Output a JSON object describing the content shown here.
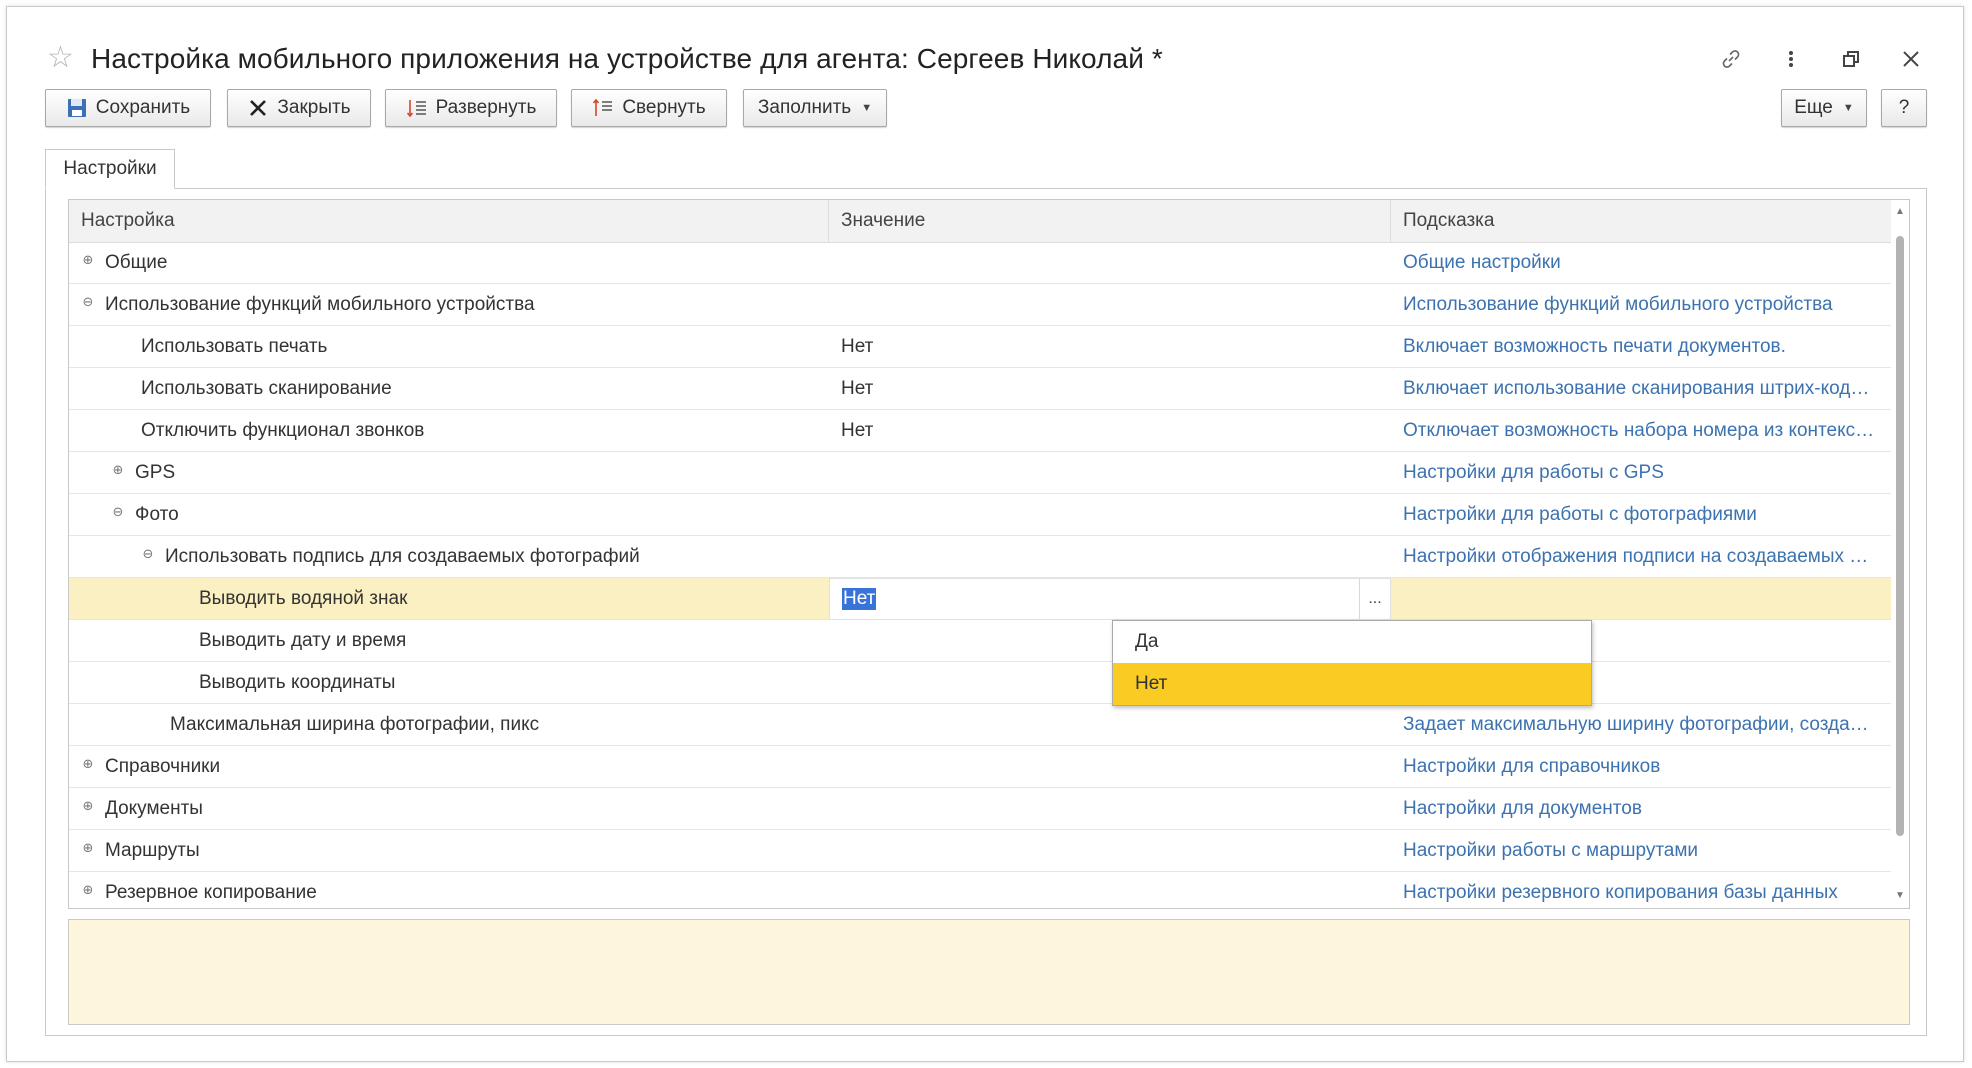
{
  "window": {
    "title": "Настройка мобильного приложения на устройстве для агента: Сергеев Николай *",
    "icons": [
      "star-icon",
      "link-icon",
      "more-icon",
      "restore-icon",
      "close-icon"
    ]
  },
  "toolbar": {
    "save_label": "Сохранить",
    "close_label": "Закрыть",
    "expand_label": "Развернуть",
    "collapse_label": "Свернуть",
    "fill_label": "Заполнить",
    "more_label": "Еще",
    "help_label": "?"
  },
  "tabs": [
    {
      "label": "Настройки"
    }
  ],
  "table": {
    "columns": {
      "setting": "Настройка",
      "value": "Значение",
      "hint": "Подсказка"
    },
    "rows": [
      {
        "name": "Общие",
        "value": "",
        "hint": "Общие настройки",
        "expander": "⊕"
      },
      {
        "name": "Использование функций мобильного устройства",
        "value": "",
        "hint": "Использование функций мобильного устройства",
        "expander": "⊖"
      },
      {
        "name": "Использовать печать",
        "value": "Нет",
        "hint": "Включает возможность печати документов.",
        "expander": ""
      },
      {
        "name": "Использовать сканирование",
        "value": "Нет",
        "hint": "Включает использование сканирования штрих-кодов и QR-кодов",
        "expander": ""
      },
      {
        "name": "Отключить функционал звонков",
        "value": "Нет",
        "hint": "Отключает возможность набора номера из контекстного меню",
        "expander": ""
      },
      {
        "name": "GPS",
        "value": "",
        "hint": "Настройки для работы с GPS",
        "expander": "⊕"
      },
      {
        "name": "Фото",
        "value": "",
        "hint": "Настройки для работы с фотографиями",
        "expander": "⊖"
      },
      {
        "name": "Использовать подпись для создаваемых фотографий",
        "value": "",
        "hint": "Настройки отображения подписи на создаваемых фотографиях",
        "expander": "⊖"
      },
      {
        "name": "Выводить водяной знак",
        "value": "Нет",
        "hint": "",
        "expander": ""
      },
      {
        "name": "Выводить дату и время",
        "value": "",
        "hint": "",
        "expander": ""
      },
      {
        "name": "Выводить координаты",
        "value": "",
        "hint": "",
        "expander": ""
      },
      {
        "name": "Максимальная ширина фотографии, пикс",
        "value": "",
        "hint": "Задает максимальную ширину фотографии, создаваемой на устройстве",
        "expander": ""
      },
      {
        "name": "Справочники",
        "value": "",
        "hint": "Настройки для справочников",
        "expander": "⊕"
      },
      {
        "name": "Документы",
        "value": "",
        "hint": "Настройки для документов",
        "expander": "⊕"
      },
      {
        "name": "Маршруты",
        "value": "",
        "hint": "Настройки работы с маршрутами",
        "expander": "⊕"
      },
      {
        "name": "Резервное копирование",
        "value": "",
        "hint": "Настройки резервного копирования базы данных",
        "expander": "⊕"
      }
    ],
    "edit": {
      "value": "Нет",
      "button": "..."
    },
    "dropdown": {
      "options": [
        "Да",
        "Нет"
      ],
      "selected": "Нет"
    }
  },
  "colors": {
    "selected_row": "#fbf0c2",
    "hint_link": "#3c72b0",
    "dropdown_active": "#f9cb23",
    "info_area": "#fdf6dc"
  }
}
